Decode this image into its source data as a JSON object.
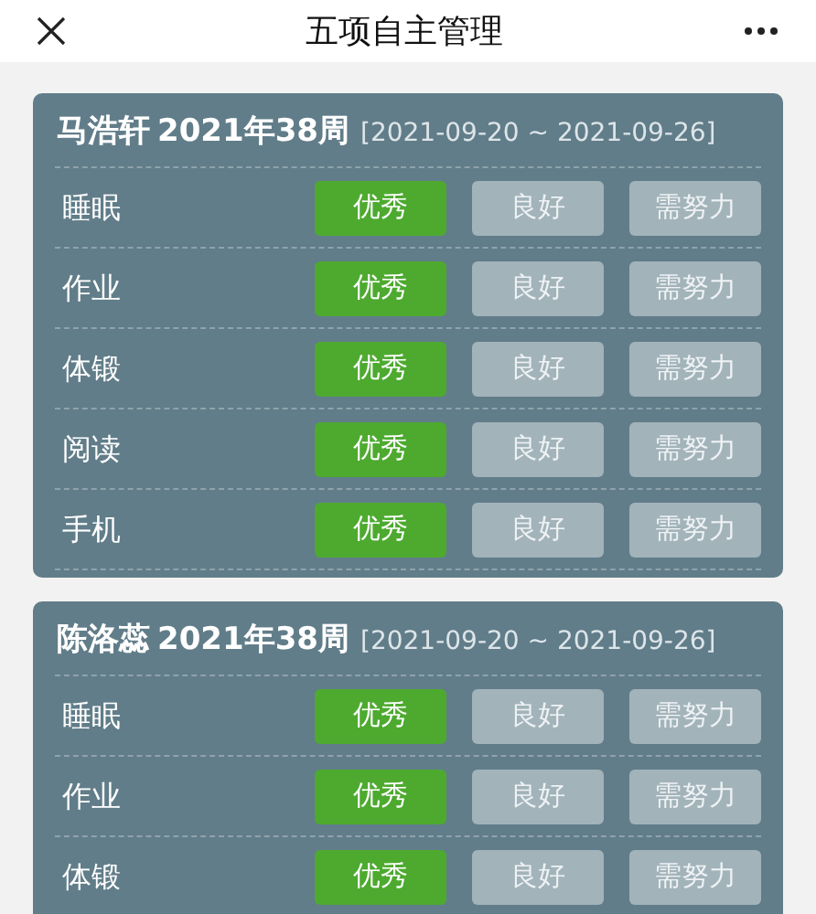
{
  "header": {
    "title": "五项自主管理"
  },
  "cards": [
    {
      "name": "马浩轩",
      "week": "2021年38周",
      "range": "[2021-09-20 ~ 2021-09-26]",
      "rows": [
        {
          "label": "睡眠",
          "options": [
            {
              "label": "优秀",
              "selected": true
            },
            {
              "label": "良好",
              "selected": false
            },
            {
              "label": "需努力",
              "selected": false
            }
          ]
        },
        {
          "label": "作业",
          "options": [
            {
              "label": "优秀",
              "selected": true
            },
            {
              "label": "良好",
              "selected": false
            },
            {
              "label": "需努力",
              "selected": false
            }
          ]
        },
        {
          "label": "体锻",
          "options": [
            {
              "label": "优秀",
              "selected": true
            },
            {
              "label": "良好",
              "selected": false
            },
            {
              "label": "需努力",
              "selected": false
            }
          ]
        },
        {
          "label": "阅读",
          "options": [
            {
              "label": "优秀",
              "selected": true
            },
            {
              "label": "良好",
              "selected": false
            },
            {
              "label": "需努力",
              "selected": false
            }
          ]
        },
        {
          "label": "手机",
          "options": [
            {
              "label": "优秀",
              "selected": true
            },
            {
              "label": "良好",
              "selected": false
            },
            {
              "label": "需努力",
              "selected": false
            }
          ]
        }
      ]
    },
    {
      "name": "陈洛蕊",
      "week": "2021年38周",
      "range": "[2021-09-20 ~ 2021-09-26]",
      "rows": [
        {
          "label": "睡眠",
          "options": [
            {
              "label": "优秀",
              "selected": true
            },
            {
              "label": "良好",
              "selected": false
            },
            {
              "label": "需努力",
              "selected": false
            }
          ]
        },
        {
          "label": "作业",
          "options": [
            {
              "label": "优秀",
              "selected": true
            },
            {
              "label": "良好",
              "selected": false
            },
            {
              "label": "需努力",
              "selected": false
            }
          ]
        },
        {
          "label": "体锻",
          "options": [
            {
              "label": "优秀",
              "selected": true
            },
            {
              "label": "良好",
              "selected": false
            },
            {
              "label": "需努力",
              "selected": false
            }
          ]
        }
      ]
    }
  ]
}
